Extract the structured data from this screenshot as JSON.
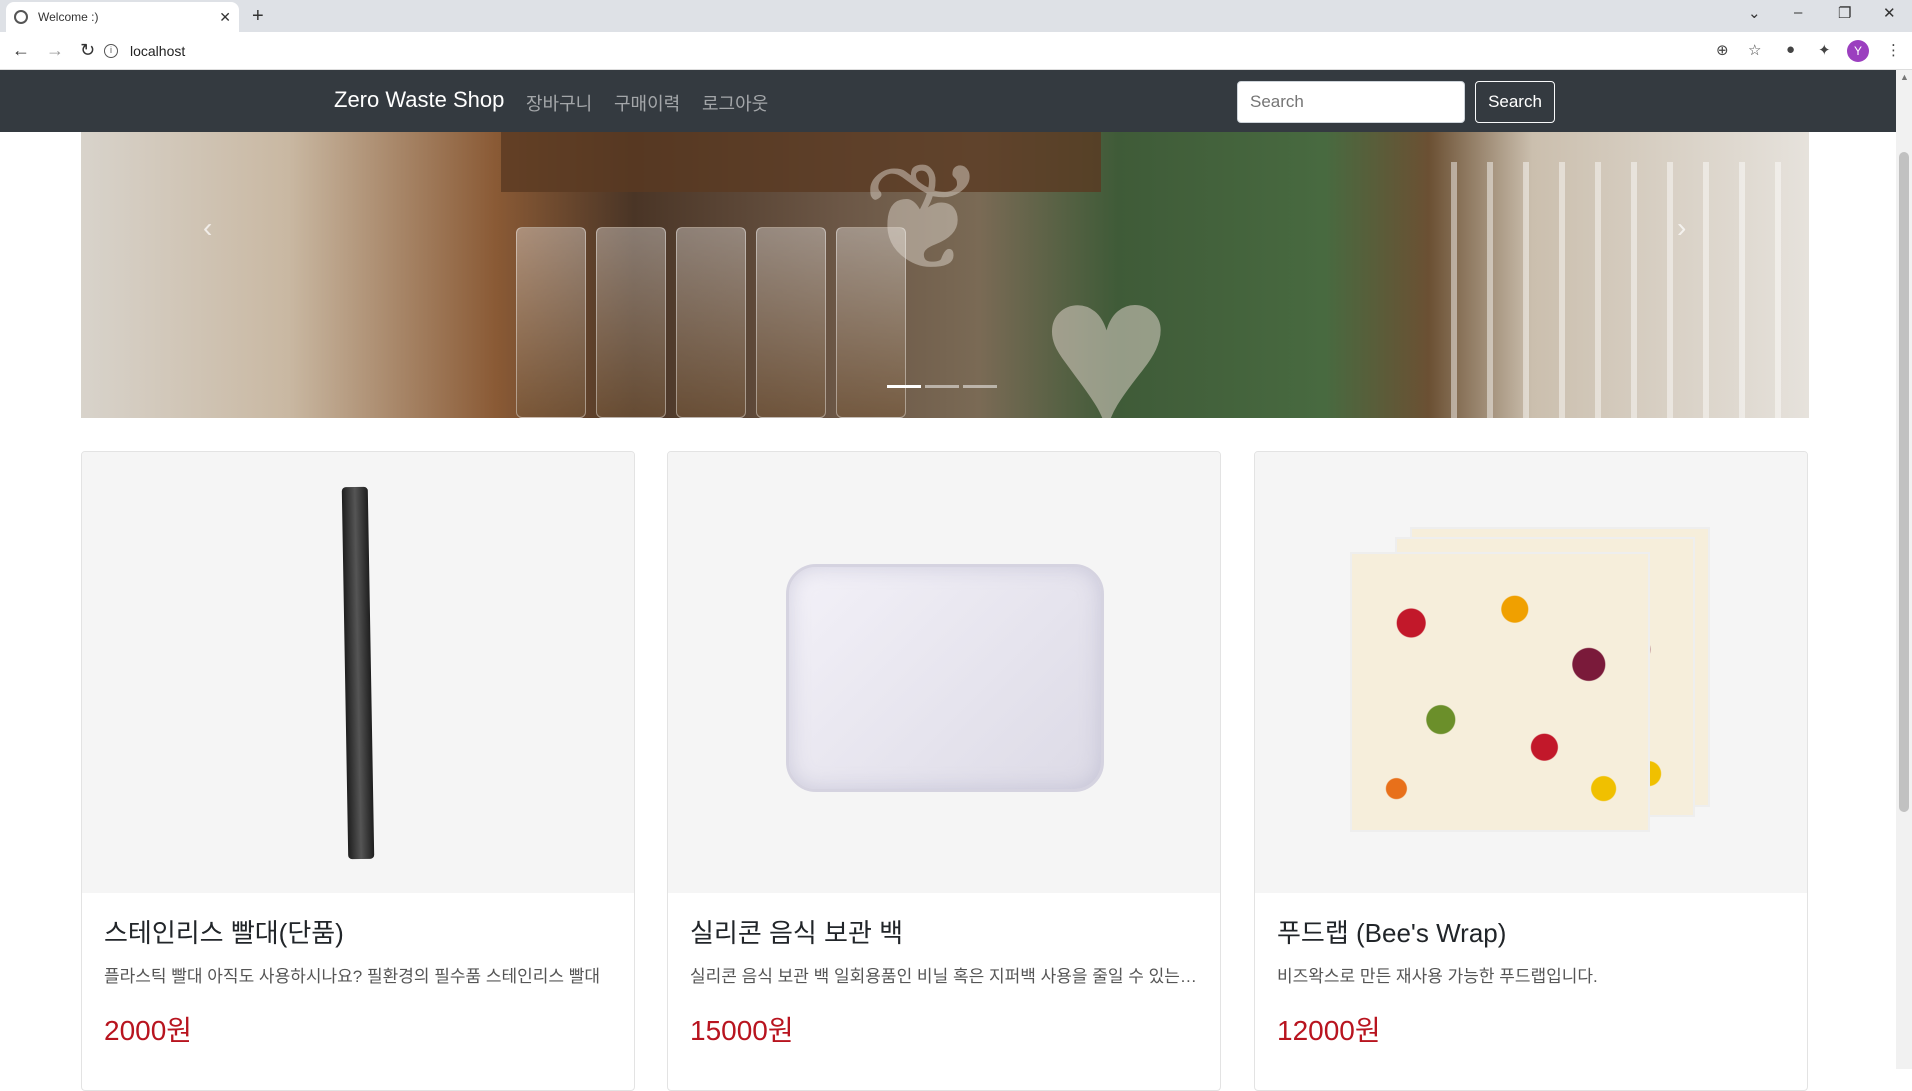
{
  "browser": {
    "tab_title": "Welcome :)",
    "tab_close": "✕",
    "new_tab": "+",
    "url": "localhost",
    "profile_initial": "Y",
    "window_controls": [
      "⌄",
      "–",
      "❐",
      "✕"
    ]
  },
  "navbar": {
    "brand": "Zero Waste Shop",
    "links": [
      "장바구니",
      "구매이력",
      "로그아웃"
    ],
    "search_placeholder": "Search",
    "search_button": "Search"
  },
  "carousel": {
    "slide_count": 3,
    "active_index": 0,
    "prev_icon": "‹",
    "next_icon": "›"
  },
  "products": [
    {
      "name": "스테인리스 빨대(단품)",
      "description": "플라스틱 빨대 아직도 사용하시나요? 필환경의 필수품 스테인리스 빨대",
      "price": "2000원",
      "image_icon": "straw-image"
    },
    {
      "name": "실리콘 음식 보관 백",
      "description": "실리콘 음식 보관 백 일회용품인 비닐 혹은 지퍼백 사용을 줄일 수 있는 보관 백",
      "price": "15000원",
      "image_icon": "silicone-bag-image"
    },
    {
      "name": "푸드랩 (Bee's Wrap)",
      "description": "비즈왁스로 만든 재사용 가능한 푸드랩입니다.",
      "price": "12000원",
      "image_icon": "food-wrap-image"
    }
  ],
  "colors": {
    "navbar_bg": "#343a40",
    "price": "#b8141f"
  }
}
